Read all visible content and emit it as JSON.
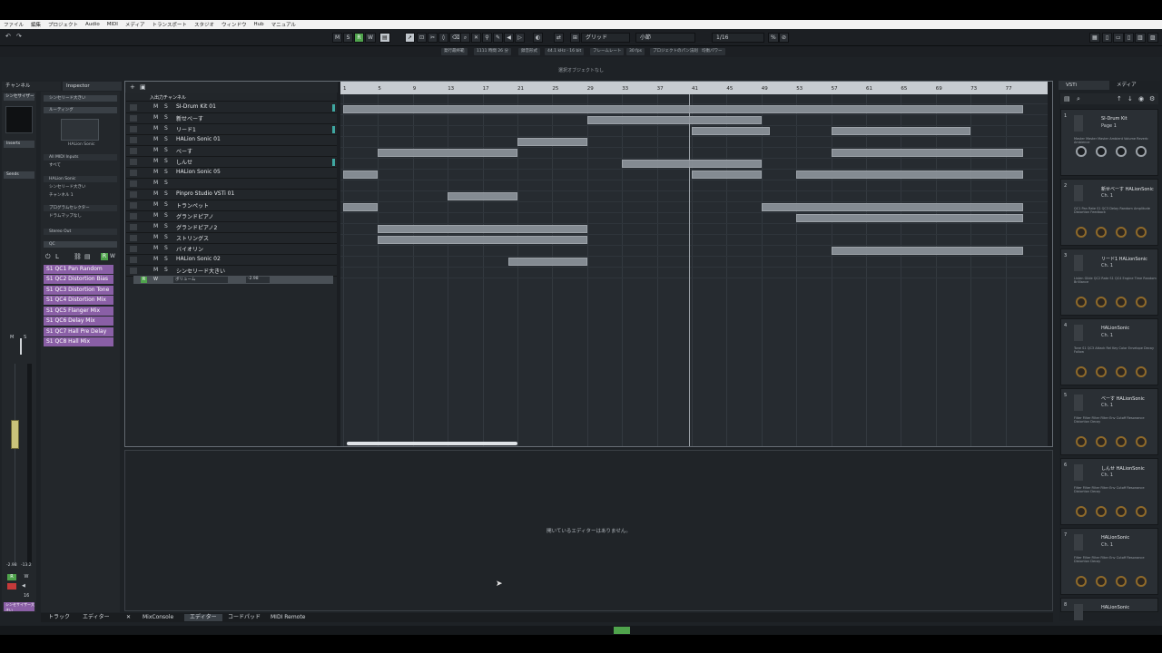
{
  "menubar": [
    "ファイル",
    "編集",
    "プロジェクト",
    "Audio",
    "MIDI",
    "メディア",
    "トランスポート",
    "スタジオ",
    "ウィンドウ",
    "Hub",
    "マニュアル"
  ],
  "toolbar": {
    "m_label": "M",
    "s_label": "S",
    "r_label": "R",
    "w_label": "W",
    "grid_type": "グリッド",
    "grid_value": "小節",
    "quantize": "1/16"
  },
  "infobar": [
    "発行最終範",
    "1111 時間 26 分",
    "録音形式",
    "44.1 kHz - 16 bit",
    "フレームレート",
    "30 fps",
    "プロジェクトのパン法則",
    "均衡パワー"
  ],
  "status": "選択オブジェクトなし",
  "left_tabs": [
    "チャンネル",
    "Inspector"
  ],
  "channel": {
    "name": "シンセサイザー大きい",
    "inserts": "Inserts",
    "sends": "Sends",
    "vol_l": "-2.98",
    "vol_r": "-13.2",
    "num": "16",
    "bottom_name": "シンセサイザー大きい"
  },
  "inspector": {
    "track_name": "シンセリード大きい",
    "routing": "ルーティング",
    "plugin_name": "HALion Sonic",
    "midi_in": "All MIDI Inputs",
    "filter": "すべて",
    "inst": "HALion Sonic",
    "inst2": "シンセリード大きい",
    "channel": "チャンネル 1",
    "prog_sel": "プログラムセレクター",
    "drum": "ドラムマップなし",
    "out": "Stereo Out",
    "qc_header": "QC",
    "qc": [
      "S1 QC1 Pan Random",
      "S1 QC2 Distortion Bias",
      "S1 QC3 Distortion Tone",
      "S1 QC4 Distortion Mix",
      "S1 QC5 Flanger Mix",
      "S1 QC6 Delay Mix",
      "S1 QC7 Hall Pre Delay",
      "S1 QC8 Hall Mix"
    ]
  },
  "tracks": {
    "header": "入出力チャンネル",
    "m": "M",
    "s": "S",
    "items": [
      "SI-Drum Kit 01",
      "新せべーす",
      "リード1",
      "HALion Sonic 01",
      "べーす",
      "しんせ",
      "HALion Sonic 05",
      "",
      "Pinpro Studio VSTi 01",
      "トランペット",
      "グランドピアノ",
      "グランドピアノ2",
      "ストリングス",
      "バイオリン",
      "HALion Sonic 02",
      "シンセリード大きい"
    ],
    "volume_label": "ボリューム",
    "volume_value": "-2.98"
  },
  "ruler": [
    "1",
    "5",
    "9",
    "13",
    "17",
    "21",
    "25",
    "29",
    "33",
    "37",
    "41",
    "45",
    "49",
    "53",
    "57",
    "61",
    "65",
    "69",
    "73",
    "77"
  ],
  "editor_msg": "開いているエディターはありません。",
  "bottom_tabs": [
    "トラック",
    "エディター",
    "MixConsole",
    "エディター",
    "コードパッド",
    "MIDI Remote"
  ],
  "right": {
    "tabs": [
      "VSTi",
      "メディア"
    ],
    "slots": [
      {
        "num": "1",
        "name": "SI-Drum Kit",
        "sub": "Page 1",
        "labels": "Master Master Master Ambient Volume Reverb Ambience",
        "knob": "gray"
      },
      {
        "num": "2",
        "name": "新せべーす HALionSonic",
        "sub": "Ch. 1",
        "labels": "QC1 Pan Rate S1 QC3 Delay Random Amplitude Distortion Feedback",
        "knob": "gold"
      },
      {
        "num": "3",
        "name": "リード1 HALionSonic",
        "sub": "Ch. 1",
        "labels": "Listen Glide QC2 Rate S1 QC4 Engine Time Random Brilliance",
        "knob": "gold"
      },
      {
        "num": "4",
        "name": "HALionSonic",
        "sub": "Ch. 1",
        "labels": "Tone S1 QC3 Attack Rel Key Color Envelope Decay Follow",
        "knob": "gold"
      },
      {
        "num": "5",
        "name": "べーす HALionSonic",
        "sub": "Ch. 1",
        "labels": "Filter Filter Filter Filter Env Cutoff Resonance Distortion Decay",
        "knob": "gold"
      },
      {
        "num": "6",
        "name": "しんせ HALionSonic",
        "sub": "Ch. 1",
        "labels": "Filter Filter Filter Filter Env Cutoff Resonance Distortion Decay",
        "knob": "gold"
      },
      {
        "num": "7",
        "name": "HALionSonic",
        "sub": "Ch. 1",
        "labels": "Filter Filter Filter Filter Env Cutoff Resonance Distortion Decay",
        "knob": "gold"
      },
      {
        "num": "8",
        "name": "HALionSonic",
        "sub": "",
        "labels": "",
        "knob": "gold"
      }
    ]
  }
}
